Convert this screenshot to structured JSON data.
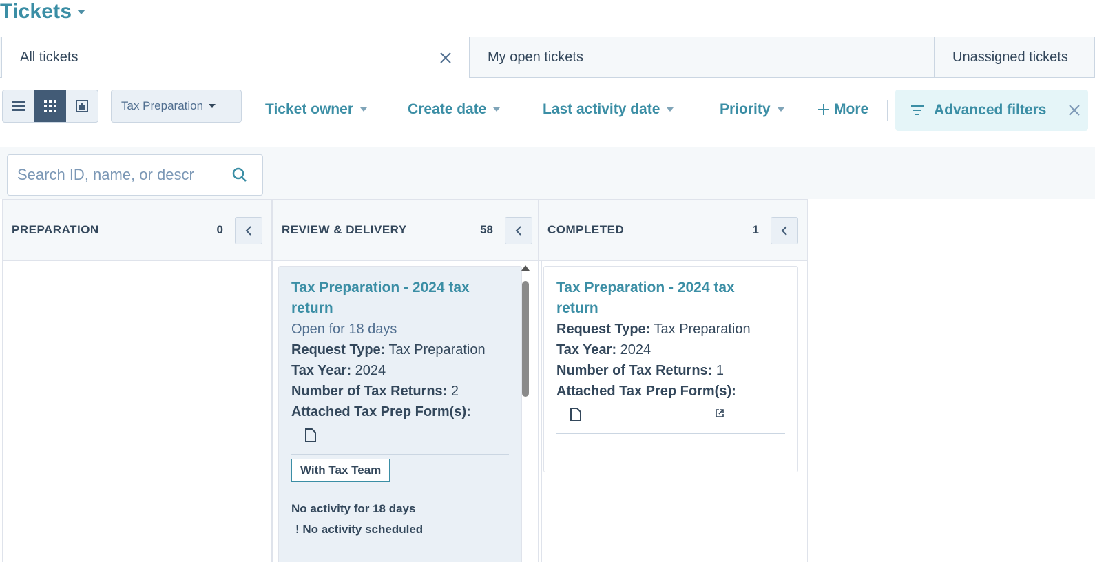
{
  "header": {
    "title": "Tickets"
  },
  "tabs": [
    {
      "label": "All tickets",
      "active": true
    },
    {
      "label": "My open tickets"
    },
    {
      "label": "Unassigned tickets"
    }
  ],
  "toolbar": {
    "views": [
      "list-view-icon",
      "board-view-icon",
      "report-view-icon"
    ],
    "pipeline": "Tax Preparation",
    "filters": {
      "ticket_owner": "Ticket owner",
      "create_date": "Create date",
      "last_activity_date": "Last activity date",
      "priority": "Priority",
      "more": "More"
    },
    "advanced_filters": "Advanced filters"
  },
  "search": {
    "placeholder": "Search ID, name, or descr"
  },
  "columns": [
    {
      "name": "PREPARATION",
      "count": "0"
    },
    {
      "name": "REVIEW & DELIVERY",
      "count": "58"
    },
    {
      "name": "COMPLETED",
      "count": "1"
    }
  ],
  "cards": {
    "review": {
      "title_line1": "Tax Preparation - 2024 tax",
      "title_line2": "return",
      "open_for": "Open for 18 days",
      "request_type_label": "Request Type:",
      "request_type": "Tax Preparation",
      "tax_year_label": "Tax Year:",
      "tax_year": "2024",
      "num_returns_label": "Number of Tax Returns:",
      "num_returns": "2",
      "attached_label": "Attached Tax Prep Form(s):",
      "tag": "With Tax Team",
      "no_activity": "No activity for 18 days",
      "no_scheduled": "! No activity scheduled"
    },
    "completed": {
      "title_line1": "Tax Preparation - 2024 tax",
      "title_line2": "return",
      "request_type_label": "Request Type:",
      "request_type": "Tax Preparation",
      "tax_year_label": "Tax Year:",
      "tax_year": "2024",
      "num_returns_label": "Number of Tax Returns:",
      "num_returns": "1",
      "attached_label": "Attached Tax Prep Form(s):"
    }
  },
  "colors": {
    "accent": "#3b8ea5",
    "text": "#33475b",
    "panel": "#f5f8fa",
    "active_view": "#425b76"
  }
}
